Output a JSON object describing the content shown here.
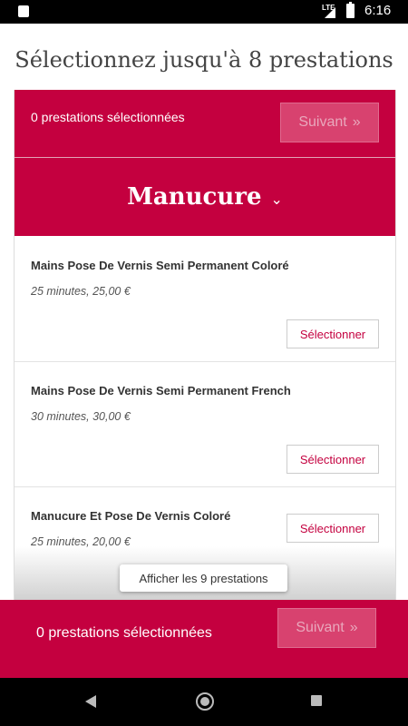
{
  "statusbar": {
    "network": "LTE",
    "time": "6:16"
  },
  "page": {
    "title": "Sélectionnez jusqu'à 8 prestations"
  },
  "selection": {
    "count_text": "0 prestations sélectionnées",
    "next_label": "Suivant",
    "next_icon": "double-chevron-right-icon"
  },
  "category": {
    "title": "Manucure",
    "icon": "chevron-down-icon"
  },
  "services": [
    {
      "name": "Mains Pose De Vernis Semi Permanent Coloré",
      "meta": "25 minutes, 25,00 €",
      "button": "Sélectionner"
    },
    {
      "name": "Mains Pose De Vernis Semi Permanent French",
      "meta": "30 minutes, 30,00 €",
      "button": "Sélectionner"
    },
    {
      "name": "Manucure Et Pose De Vernis Coloré",
      "meta": "25 minutes, 20,00 €",
      "button": "Sélectionner"
    }
  ],
  "show_all_label": "Afficher les 9 prestations",
  "bottom": {
    "count_text": "0 prestations sélectionnées",
    "next_label": "Suivant"
  },
  "colors": {
    "brand": "#c4003f"
  }
}
